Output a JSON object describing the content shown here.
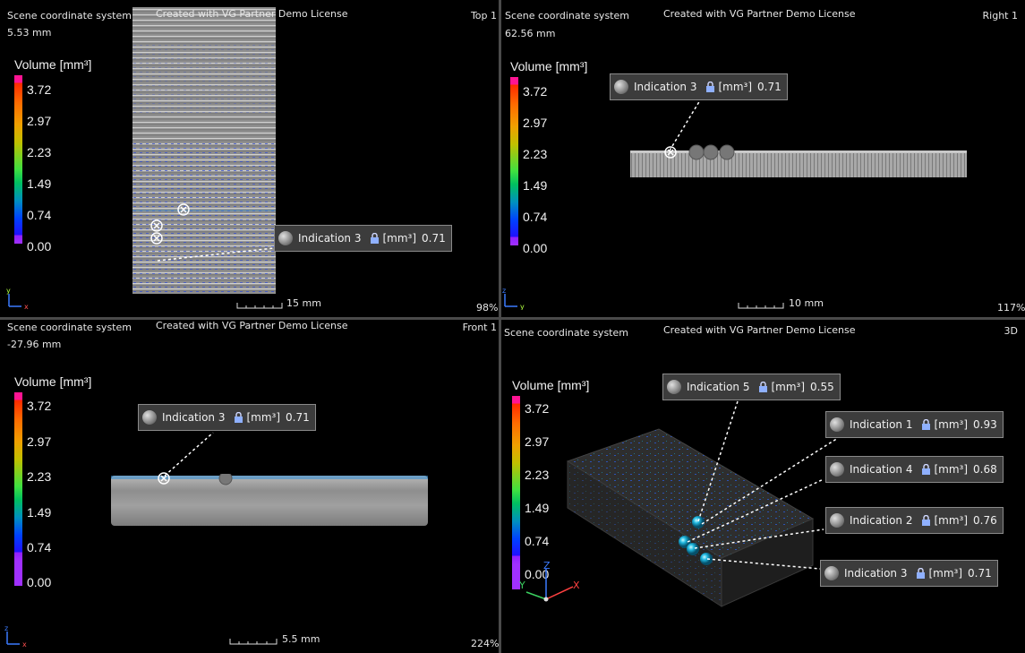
{
  "viewports": {
    "top": {
      "coord": "Scene coordinate system",
      "dist": "5.53 mm",
      "license": "Created with VG Partner Demo License",
      "name": "Top 1",
      "zoom": "98%",
      "scale": "15 mm",
      "axes": {
        "v": "y",
        "h": "x"
      },
      "indication": {
        "label": "Indication 3",
        "unit": "[mm³]",
        "value": "0.71"
      }
    },
    "right": {
      "coord": "Scene coordinate system",
      "dist": "62.56 mm",
      "license": "Created with VG Partner Demo License",
      "name": "Right 1",
      "zoom": "117%",
      "scale": "10 mm",
      "axes": {
        "v": "z",
        "h": "y"
      },
      "indication": {
        "label": "Indication 3",
        "unit": "[mm³]",
        "value": "0.71"
      }
    },
    "front": {
      "coord": "Scene coordinate system",
      "dist": "-27.96 mm",
      "license": "Created with VG Partner Demo License",
      "name": "Front 1",
      "zoom": "224%",
      "scale": "5.5 mm",
      "axes": {
        "v": "z",
        "h": "x"
      },
      "indication": {
        "label": "Indication 3",
        "unit": "[mm³]",
        "value": "0.71"
      }
    },
    "view3d": {
      "coord": "Scene coordinate system",
      "license": "Created with VG Partner Demo License",
      "name": "3D",
      "axes": {
        "z": "Z",
        "y": "Y",
        "x": "X"
      },
      "indications": [
        {
          "label": "Indication 5",
          "unit": "[mm³]",
          "value": "0.55"
        },
        {
          "label": "Indication 1",
          "unit": "[mm³]",
          "value": "0.93"
        },
        {
          "label": "Indication 4",
          "unit": "[mm³]",
          "value": "0.68"
        },
        {
          "label": "Indication 2",
          "unit": "[mm³]",
          "value": "0.76"
        },
        {
          "label": "Indication 3",
          "unit": "[mm³]",
          "value": "0.71"
        }
      ]
    }
  },
  "legend": {
    "title": "Volume [mm³]",
    "values": [
      "3.72",
      "2.97",
      "2.23",
      "1.49",
      "0.74",
      "0.00"
    ]
  },
  "colors": {
    "background": "#000000",
    "label_bg": "#3c3c3c",
    "label_border": "#8a8a8a",
    "divider": "#4a4a4a"
  }
}
